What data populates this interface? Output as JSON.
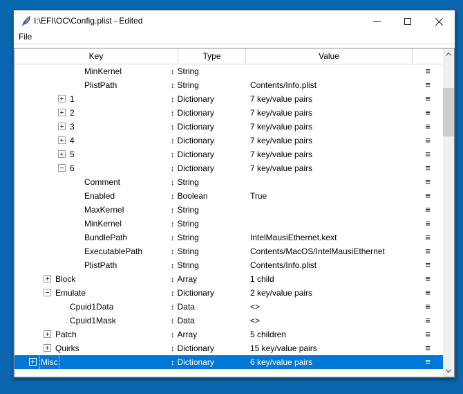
{
  "desktop": {
    "background_color": "#0a66ad"
  },
  "window": {
    "title": "I:\\EFI\\OC\\Config.plist - Edited",
    "app_icon": "python-feather-icon",
    "controls": [
      "minimize",
      "maximize",
      "close"
    ]
  },
  "menubar": {
    "items": [
      {
        "label": "File"
      }
    ]
  },
  "tree": {
    "headers": [
      "Key",
      "Type",
      "Value",
      ""
    ],
    "type_icon": "↕",
    "row_handle_icon": "≡",
    "selection_color": "#0078d7",
    "rows": [
      {
        "level": 4,
        "expander": null,
        "key": "MinKernel",
        "type": "String",
        "value": "",
        "selected": false
      },
      {
        "level": 4,
        "expander": null,
        "key": "PlistPath",
        "type": "String",
        "value": "Contents/Info.plist",
        "selected": false
      },
      {
        "level": 3,
        "expander": "collapsed",
        "key": "1",
        "type": "Dictionary",
        "value": "7 key/value pairs",
        "selected": false
      },
      {
        "level": 3,
        "expander": "collapsed",
        "key": "2",
        "type": "Dictionary",
        "value": "7 key/value pairs",
        "selected": false
      },
      {
        "level": 3,
        "expander": "collapsed",
        "key": "3",
        "type": "Dictionary",
        "value": "7 key/value pairs",
        "selected": false
      },
      {
        "level": 3,
        "expander": "collapsed",
        "key": "4",
        "type": "Dictionary",
        "value": "7 key/value pairs",
        "selected": false
      },
      {
        "level": 3,
        "expander": "collapsed",
        "key": "5",
        "type": "Dictionary",
        "value": "7 key/value pairs",
        "selected": false
      },
      {
        "level": 3,
        "expander": "expanded",
        "key": "6",
        "type": "Dictionary",
        "value": "7 key/value pairs",
        "selected": false
      },
      {
        "level": 4,
        "expander": null,
        "key": "Comment",
        "type": "String",
        "value": "",
        "selected": false
      },
      {
        "level": 4,
        "expander": null,
        "key": "Enabled",
        "type": "Boolean",
        "value": "True",
        "selected": false
      },
      {
        "level": 4,
        "expander": null,
        "key": "MaxKernel",
        "type": "String",
        "value": "",
        "selected": false
      },
      {
        "level": 4,
        "expander": null,
        "key": "MinKernel",
        "type": "String",
        "value": "",
        "selected": false
      },
      {
        "level": 4,
        "expander": null,
        "key": "BundlePath",
        "type": "String",
        "value": "IntelMausiEthernet.kext",
        "selected": false
      },
      {
        "level": 4,
        "expander": null,
        "key": "ExecutablePath",
        "type": "String",
        "value": "Contents/MacOS/IntelMausiEthernet",
        "selected": false
      },
      {
        "level": 4,
        "expander": null,
        "key": "PlistPath",
        "type": "String",
        "value": "Contents/Info.plist",
        "selected": false
      },
      {
        "level": 2,
        "expander": "collapsed",
        "key": "Block",
        "type": "Array",
        "value": "1 child",
        "selected": false
      },
      {
        "level": 2,
        "expander": "expanded",
        "key": "Emulate",
        "type": "Dictionary",
        "value": "2 key/value pairs",
        "selected": false
      },
      {
        "level": 3,
        "expander": null,
        "key": "Cpuid1Data",
        "type": "Data",
        "value": "<>",
        "selected": false
      },
      {
        "level": 3,
        "expander": null,
        "key": "Cpuid1Mask",
        "type": "Data",
        "value": "<>",
        "selected": false
      },
      {
        "level": 2,
        "expander": "collapsed",
        "key": "Patch",
        "type": "Array",
        "value": "5 children",
        "selected": false
      },
      {
        "level": 2,
        "expander": "collapsed",
        "key": "Quirks",
        "type": "Dictionary",
        "value": "15 key/value pairs",
        "selected": false
      },
      {
        "level": 1,
        "expander": "collapsed",
        "key": "Misc",
        "type": "Dictionary",
        "value": "6 key/value pairs",
        "selected": true
      }
    ]
  },
  "scrollbar": {
    "up_icon": "chevron-up",
    "down_icon": "chevron-down"
  }
}
